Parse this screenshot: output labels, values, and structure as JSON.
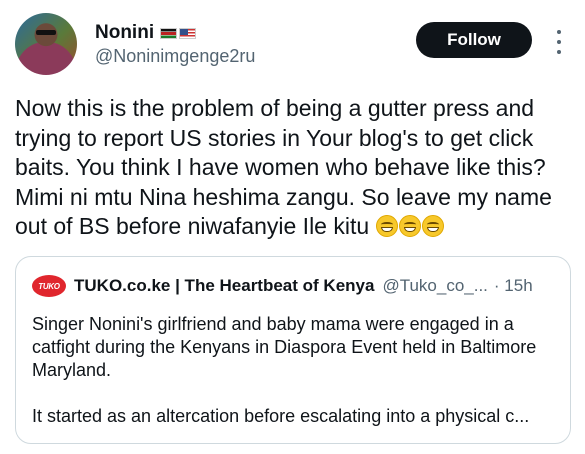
{
  "author": {
    "name": "Nonini",
    "handle": "@Noninimgenge2ru",
    "flags": [
      "kenya-flag",
      "us-flag"
    ]
  },
  "follow_label": "Follow",
  "tweet": {
    "text": "Now this is the problem of being a gutter press and trying to report US stories in Your blog's to get click baits. You think I have women who behave like this? Mimi ni mtu Nina heshima zangu. So leave my name out of BS before niwafanyie Ile kitu",
    "emojis": [
      "grinning-face-emoji",
      "grinning-face-emoji",
      "grinning-face-emoji"
    ]
  },
  "quote": {
    "logo_text": "TUKO",
    "name": "TUKO.co.ke | The Heartbeat of Kenya",
    "handle": "@Tuko_co_...",
    "time": "· 15h",
    "para1": "Singer Nonini's girlfriend and baby mama were engaged in a catfight during the Kenyans in Diaspora Event held in Baltimore Maryland.",
    "para2": "It started as an altercation before escalating into a physical c..."
  },
  "colors": {
    "follow_bg": "#0f1419",
    "secondary_text": "#536471",
    "tuko_red": "#e0262d",
    "border": "#cfd9de"
  }
}
